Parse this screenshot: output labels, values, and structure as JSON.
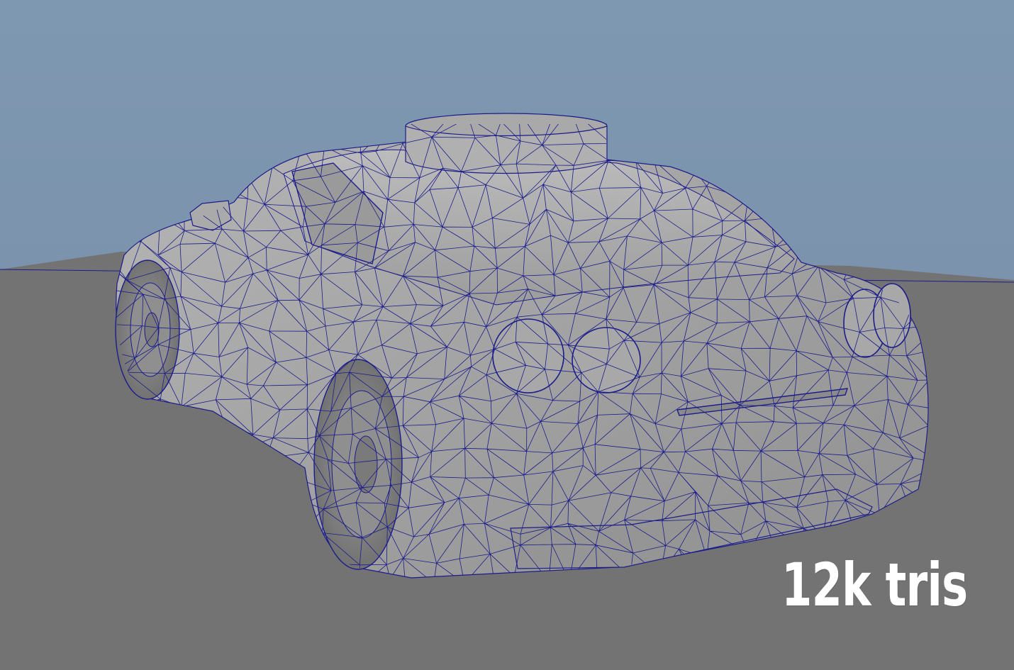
{
  "overlay": {
    "triangle_count_label": "12k tris"
  },
  "viewport": {
    "sky_color_top": "#7f98b2",
    "sky_color_bottom": "#6f85a0",
    "ground_color": "#737373",
    "mesh_fill_color": "#a2a2a2",
    "wireframe_color": "#1c1c8a",
    "shading": "wireframe-on-shaded"
  }
}
